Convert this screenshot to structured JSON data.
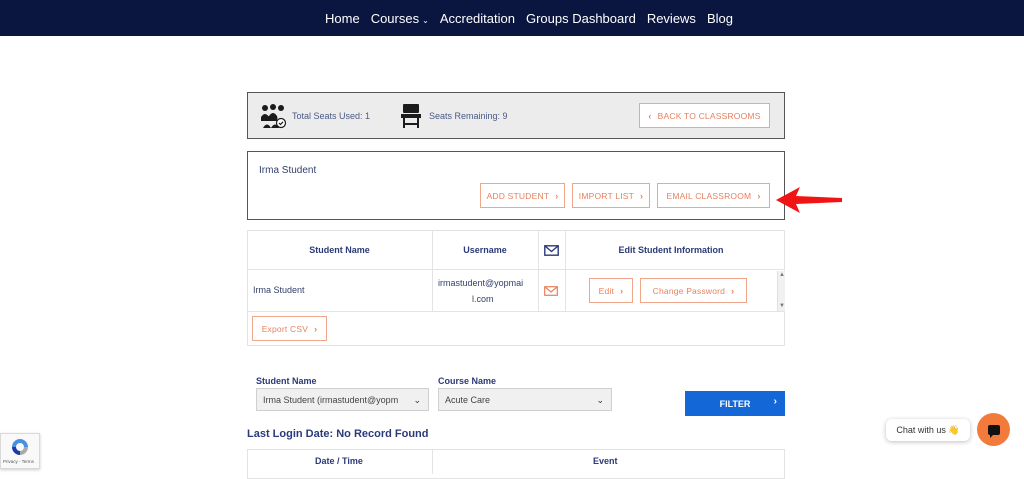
{
  "nav": {
    "items": [
      "Home",
      "Courses",
      "Accreditation",
      "Groups Dashboard",
      "Reviews",
      "Blog"
    ]
  },
  "seats": {
    "total_used": "Total Seats Used: 1",
    "remaining": "Seats Remaining: 9",
    "back_label": "BACK TO CLASSROOMS"
  },
  "classroom": {
    "name": "Irma Student",
    "add_label": "ADD STUDENT",
    "import_label": "IMPORT LIST",
    "email_label": "EMAIL CLASSROOM"
  },
  "students_table": {
    "headers": [
      "Student Name",
      "Username",
      "Edit Student Information"
    ],
    "rows": [
      {
        "name": "Irma Student",
        "username_line1": "irmastudent@yopmai",
        "username_line2": "l.com",
        "edit_label": "Edit",
        "password_label": "Change Password"
      }
    ],
    "export_label": "Export CSV"
  },
  "filters": {
    "student_label": "Student Name",
    "student_value": "Irma Student (irmastudent@yopm",
    "course_label": "Course Name",
    "course_value": "Acute Care",
    "filter_label": "FILTER"
  },
  "login": {
    "title": "Last Login Date: No Record Found",
    "headers": [
      "Date / Time",
      "Event"
    ]
  },
  "chat": {
    "label": "Chat with us 👋"
  },
  "recaptcha": {
    "terms": "Privacy - Terms"
  },
  "colors": {
    "nav_bg": "#0a1640",
    "accent_orange": "#e8805f",
    "filter_blue": "#1467d6",
    "heading_blue": "#2b3a78"
  }
}
